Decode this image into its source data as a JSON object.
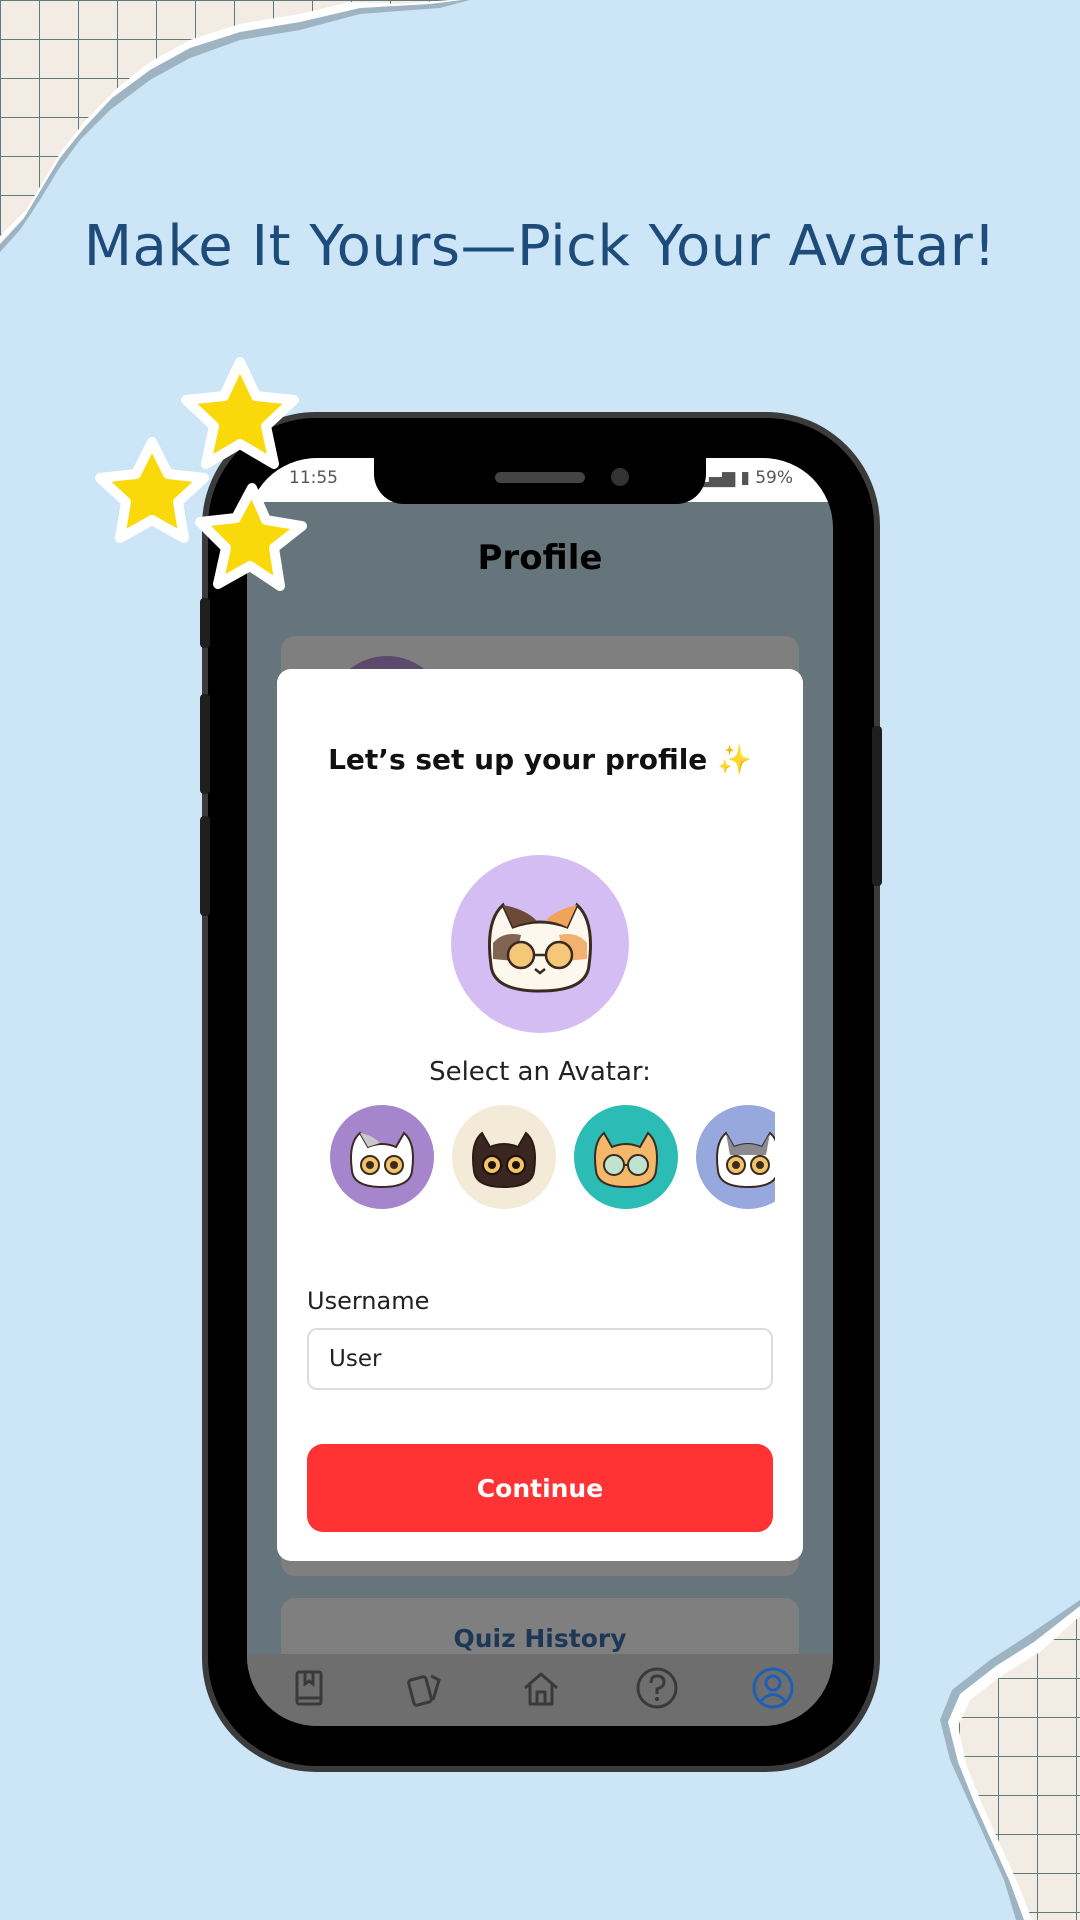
{
  "headline": "Make It Yours—Pick Your Avatar!",
  "status_bar": {
    "time": "11:55",
    "battery": "59%"
  },
  "screen": {
    "title": "Profile",
    "quiz_history": "Quiz History"
  },
  "modal": {
    "title": "Let’s set up your profile ✨",
    "select_label": "Select an Avatar:",
    "username_label": "Username",
    "username_value": "User",
    "continue_label": "Continue"
  },
  "avatars": [
    {
      "name": "grey-white-cat",
      "bg": "#a585cc"
    },
    {
      "name": "dark-brown-cat",
      "bg": "#f3ead7"
    },
    {
      "name": "orange-cat-glasses",
      "bg": "#2bbcb6"
    },
    {
      "name": "grey-tabby-cat",
      "bg": "#97a8df"
    }
  ],
  "nav": [
    "book-icon",
    "cards-icon",
    "home-icon",
    "help-icon",
    "profile-icon"
  ],
  "colors": {
    "background": "#cce6f7",
    "headline": "#1d4b7a",
    "accent": "#ff3333",
    "nav_active": "#1e5fb5"
  }
}
